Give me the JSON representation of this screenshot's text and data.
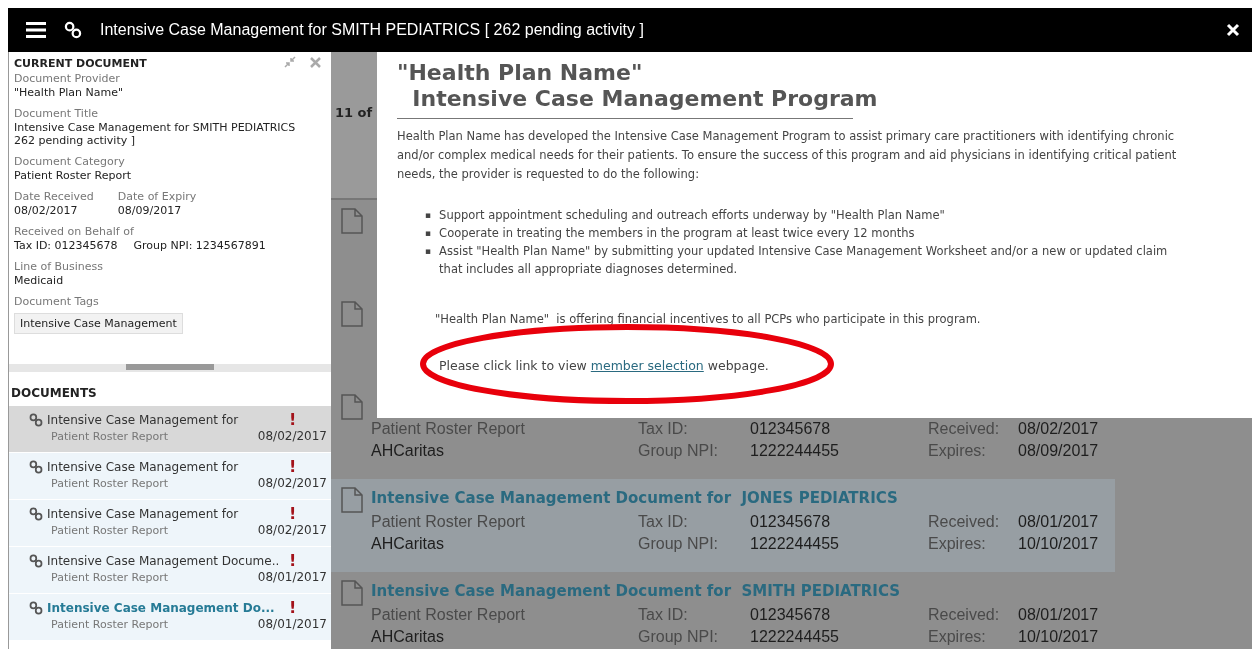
{
  "header": {
    "title": "Intensive Case Management for SMITH PEDIATRICS [ 262 pending activity ]"
  },
  "current_document": {
    "heading": "CURRENT DOCUMENT",
    "fields": [
      {
        "kind": "text",
        "label": "Document Provider",
        "values": [
          "\"Health Plan Name\""
        ]
      },
      {
        "kind": "text",
        "label": "Document Title",
        "values": [
          "Intensive Case Management for SMITH PEDIATRICS",
          "262 pending activity ]"
        ]
      },
      {
        "kind": "text",
        "label": "Document Category",
        "values": [
          "Patient Roster Report"
        ]
      },
      {
        "kind": "columns",
        "columns": [
          {
            "label": "Date Received",
            "value": "08/02/2017"
          },
          {
            "label": "Date of Expiry",
            "value": "08/09/2017"
          }
        ]
      },
      {
        "kind": "inline",
        "label": "Received on Behalf of",
        "values": [
          "Tax ID: 012345678",
          "Group NPI: 1234567891"
        ]
      },
      {
        "kind": "text",
        "label": "Line of Business",
        "values": [
          "Medicaid"
        ]
      },
      {
        "kind": "tags",
        "label": "Document Tags",
        "tags": [
          "Intensive Case Management"
        ]
      }
    ]
  },
  "documents": {
    "heading": "DOCUMENTS",
    "items": [
      {
        "title": "Intensive Case Management for",
        "category": "Patient Roster Report",
        "date": "08/02/2017",
        "flag": "!",
        "hovered": true,
        "selected": false
      },
      {
        "title": "Intensive Case Management for",
        "category": "Patient Roster Report",
        "date": "08/02/2017",
        "flag": "!",
        "hovered": false,
        "selected": false
      },
      {
        "title": "Intensive Case Management for",
        "category": "Patient Roster Report",
        "date": "08/02/2017",
        "flag": "!",
        "hovered": false,
        "selected": false
      },
      {
        "title": "Intensive Case Management Docume..",
        "category": "Patient Roster Report",
        "date": "08/01/2017",
        "flag": "!",
        "hovered": false,
        "selected": false
      },
      {
        "title": "Intensive Case Management Do...",
        "category": "Patient Roster Report",
        "date": "08/01/2017",
        "flag": "!",
        "hovered": false,
        "selected": true
      }
    ]
  },
  "results": {
    "count": "11 of",
    "rows": [
      {
        "highlighted": false
      },
      {
        "highlighted": false
      },
      {
        "highlighted": false,
        "category": "Patient Roster Report",
        "provider": "AHCaritas",
        "tax_label": "Tax ID:",
        "tax": "012345678",
        "npi_label": "Group NPI:",
        "npi": "1222244455",
        "received_label": "Received:",
        "received": "08/02/2017",
        "expires_label": "Expires:",
        "expires": "08/09/2017"
      },
      {
        "highlighted": true,
        "title": "Intensive Case Management Document for  JONES PEDIATRICS",
        "category": "Patient Roster Report",
        "provider": "AHCaritas",
        "tax_label": "Tax ID:",
        "tax": "012345678",
        "npi_label": "Group NPI:",
        "npi": "1222244455",
        "received_label": "Received:",
        "received": "08/01/2017",
        "expires_label": "Expires:",
        "expires": "10/10/2017"
      },
      {
        "highlighted": false,
        "title": "Intensive Case Management Document for  SMITH PEDIATRICS",
        "category": "Patient Roster Report",
        "provider": "AHCaritas",
        "tax_label": "Tax ID:",
        "tax": "012345678",
        "npi_label": "Group NPI:",
        "npi": "1222244455",
        "received_label": "Received:",
        "received": "08/01/2017",
        "expires_label": "Expires:",
        "expires": "10/10/2017"
      }
    ]
  },
  "modal": {
    "heading_lines": [
      "\"Health Plan Name\"",
      "Intensive Case Management Program"
    ],
    "intro": "Health Plan Name  has developed the Intensive Case  Management Program to assist primary care practitioners with identifying  chronic and/or complex medical needs for their patients. To ensure the success of this program and aid physicians in identifying critical patient needs, the provider is requested to do the following:",
    "bullets": [
      {
        "marker": "▪",
        "text": "Support appointment scheduling and outreach efforts underway by  \"Health Plan Name\""
      },
      {
        "marker": "▪",
        "text": "Cooperate in treating the members in the program at least twice every 12 months"
      },
      {
        "marker": "▪",
        "text": "Assist  \"Health Plan Name\"  by submitting your updated Intensive Case Management Worksheet and/or a new or updated claim that includes all appropriate diagnoses determined."
      }
    ],
    "incentive": "\"Health Plan Name\"  is offering financial incentives to all PCPs who participate in this program.",
    "link_sentence": {
      "before": "Please click link to view",
      "link": "member selection",
      "after": "webpage."
    },
    "annotation": {
      "kind": "ellipse"
    }
  }
}
